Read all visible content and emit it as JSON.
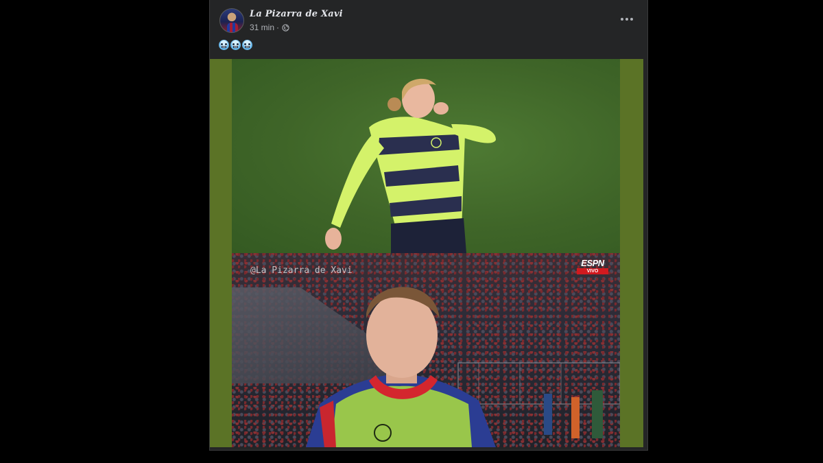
{
  "post": {
    "page_name": "La Pizarra de Xavi",
    "time": "31 min",
    "separator": "·",
    "privacy_icon": "globe-icon",
    "more_icon": "more-horizontal-icon",
    "caption_emojis": [
      "cold-face-emoji",
      "cold-face-emoji",
      "cold-face-emoji"
    ]
  },
  "media": {
    "watermark": "@La Pizarra de Xavi",
    "broadcaster": "ESPN",
    "broadcast_status": "VIVO"
  },
  "colors": {
    "page_bg": "#000000",
    "card_bg": "#242526",
    "media_bg": "#5b7326",
    "primary_text": "#e4e6eb",
    "secondary_text": "#b0b3b8"
  }
}
